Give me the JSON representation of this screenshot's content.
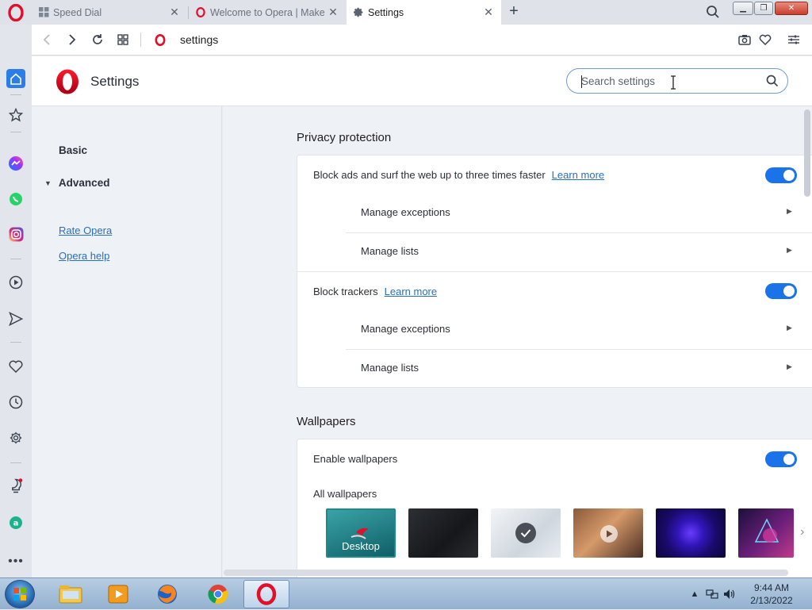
{
  "tabs": [
    {
      "title": "Speed Dial",
      "icon": "speed-dial-icon",
      "active": false
    },
    {
      "title": "Welcome to Opera | Make",
      "icon": "opera-icon",
      "active": false
    },
    {
      "title": "Settings",
      "icon": "gear-icon",
      "active": true
    }
  ],
  "address": {
    "url": "settings"
  },
  "header": {
    "title": "Settings",
    "search_placeholder": "Search settings"
  },
  "nav": {
    "basic": "Basic",
    "advanced": "Advanced",
    "links": [
      "Rate Opera",
      "Opera help"
    ]
  },
  "privacy": {
    "title": "Privacy protection",
    "block_ads": {
      "label": "Block ads and surf the web up to three times faster",
      "learn_more": "Learn more",
      "enabled": true
    },
    "ads_sub": [
      "Manage exceptions",
      "Manage lists"
    ],
    "block_trackers": {
      "label": "Block trackers",
      "learn_more": "Learn more",
      "enabled": true
    },
    "trackers_sub": [
      "Manage exceptions",
      "Manage lists"
    ]
  },
  "wallpapers": {
    "title": "Wallpapers",
    "enable_label": "Enable wallpapers",
    "enabled": true,
    "all_label": "All wallpapers",
    "items": [
      {
        "name": "Desktop",
        "caption": "Desktop",
        "selected": false
      },
      {
        "name": "Dark",
        "caption": "",
        "selected": false
      },
      {
        "name": "Light",
        "caption": "",
        "selected": true
      },
      {
        "name": "Video scene",
        "caption": "",
        "selected": false
      },
      {
        "name": "Purple swirl",
        "caption": "",
        "selected": false
      },
      {
        "name": "Neon",
        "caption": "",
        "selected": false
      }
    ]
  },
  "taskbar": {
    "apps": [
      "windows-explorer-icon",
      "media-player-icon",
      "firefox-icon",
      "chrome-icon",
      "opera-icon"
    ],
    "time": "9:44 AM",
    "date": "2/13/2022"
  },
  "colors": {
    "accent": "#1a73e8",
    "opera_red": "#e0102a",
    "link": "#2a6fb8"
  }
}
